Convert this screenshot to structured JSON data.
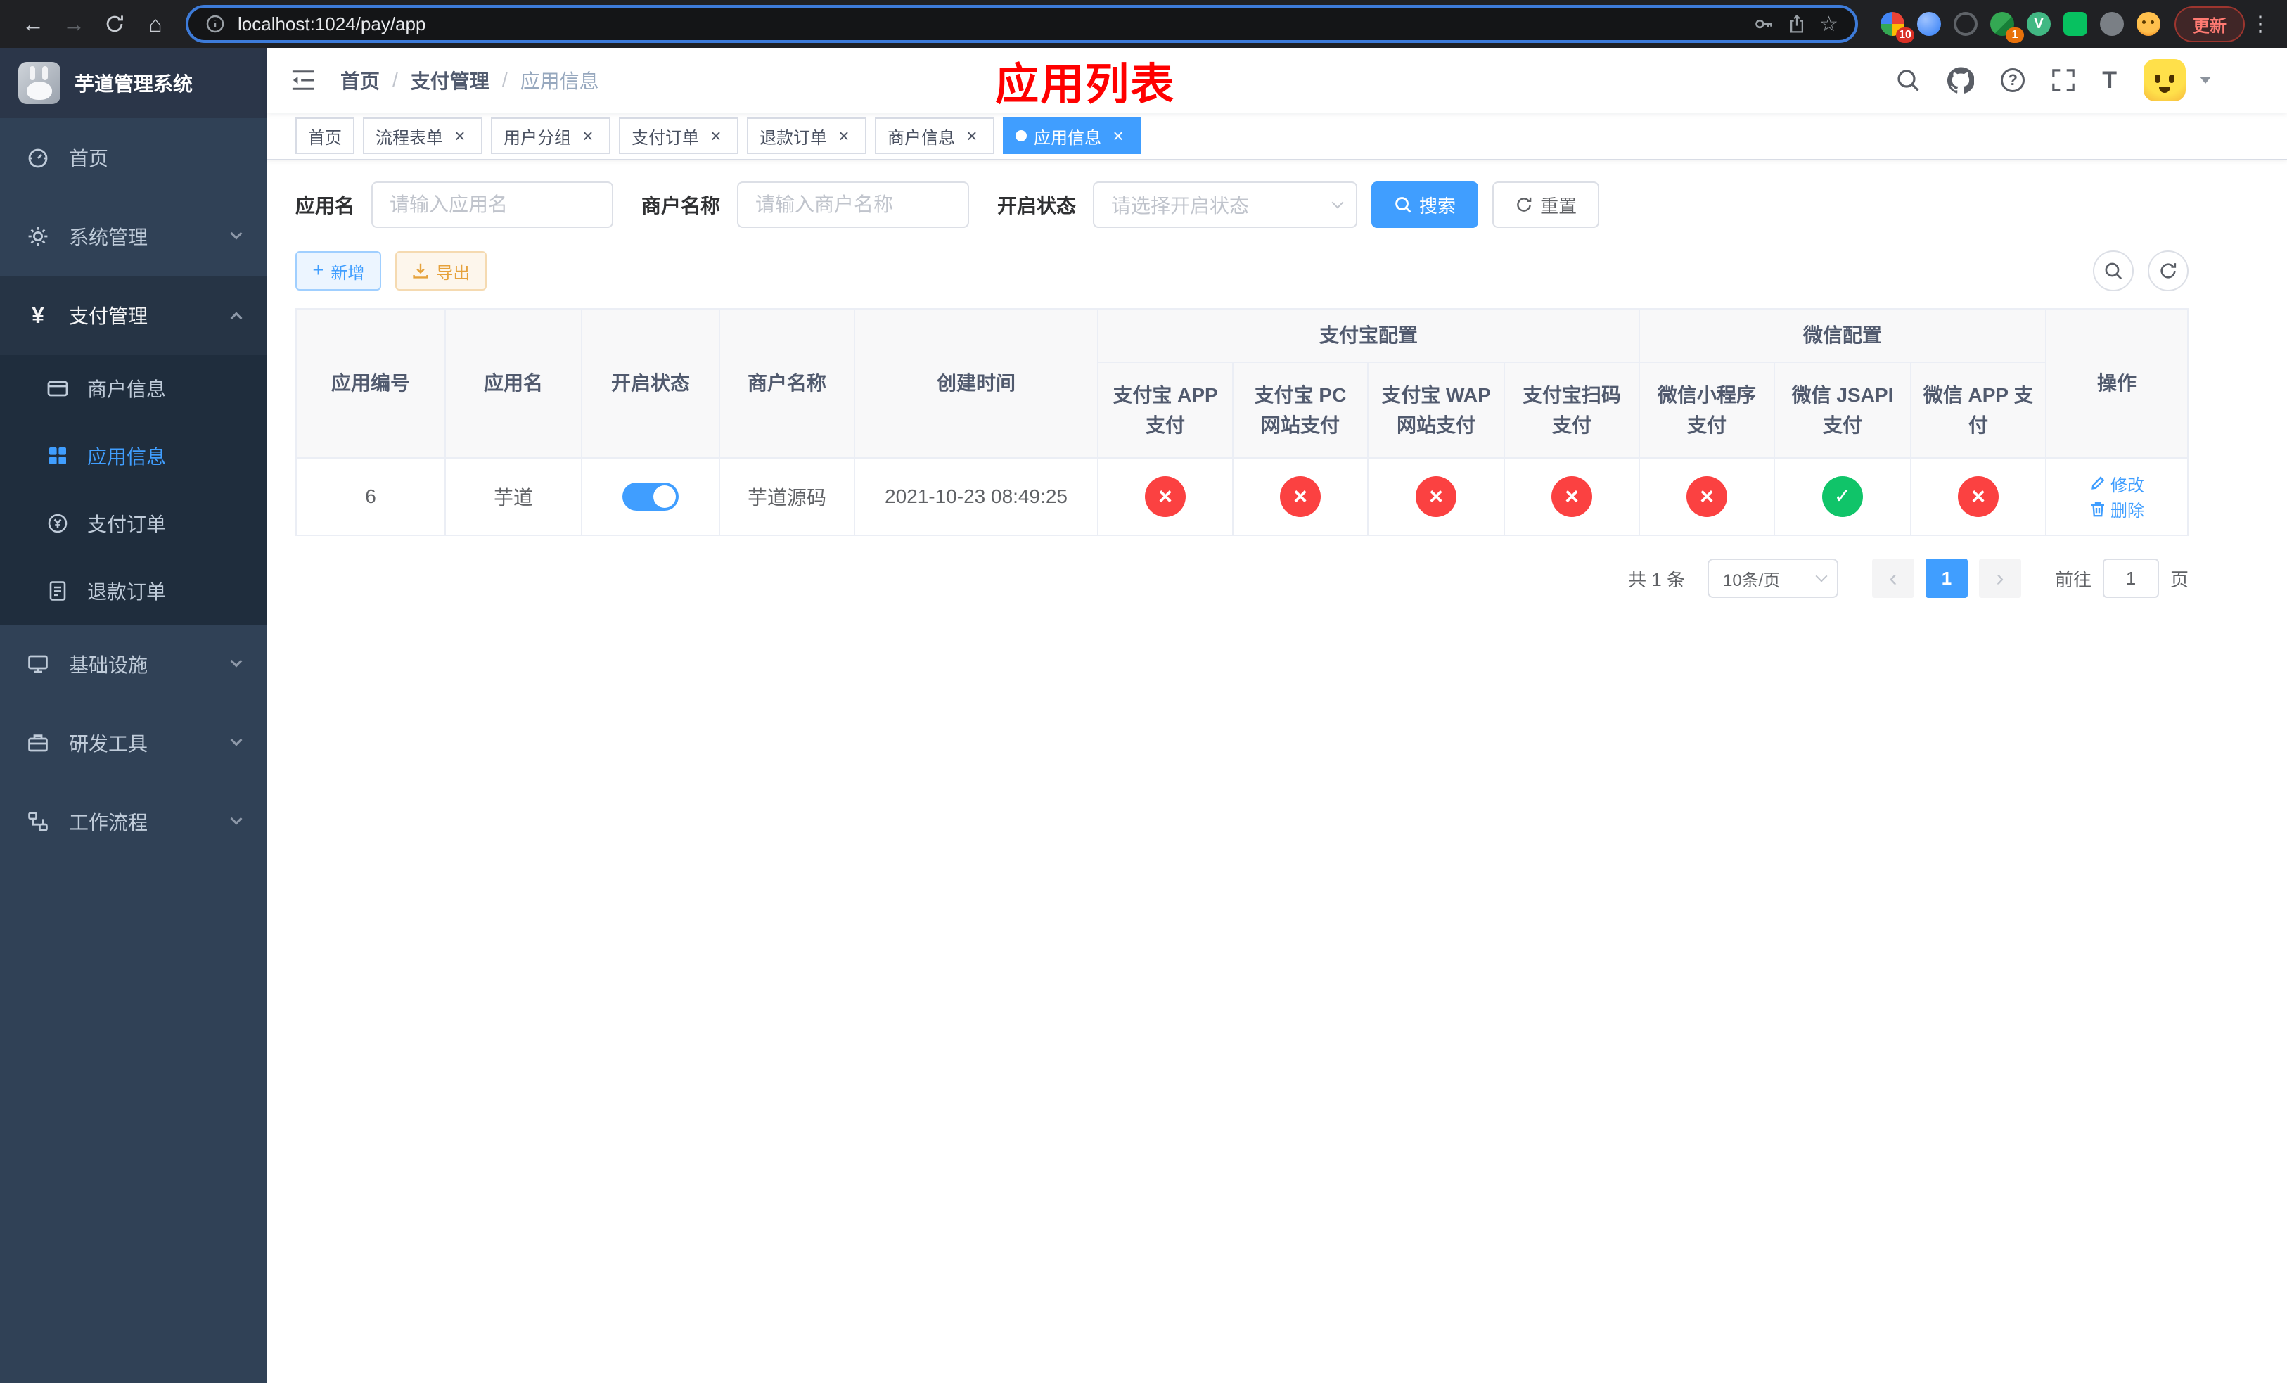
{
  "colors": {
    "primary": "#409eff",
    "danger_circle": "#fb4141",
    "success_circle": "#10c469",
    "warning": "#e6a23c",
    "sidebar_bg": "#304156",
    "title_red": "#ff0000"
  },
  "browser": {
    "url": "localhost:1024/pay/app",
    "update_label": "更新",
    "extension_badge_count": "10",
    "translate_badge_count": "1"
  },
  "sidebar": {
    "title": "芋道管理系统",
    "menu_home": "首页",
    "menu_system": "系统管理",
    "menu_pay": "支付管理",
    "menu_infra": "基础设施",
    "menu_devtools": "研发工具",
    "menu_workflow": "工作流程",
    "sub_merchant": "商户信息",
    "sub_app": "应用信息",
    "sub_pay_order": "支付订单",
    "sub_refund_order": "退款订单"
  },
  "header": {
    "crumb_home": "首页",
    "crumb_pay": "支付管理",
    "crumb_current": "应用信息",
    "separator": "/",
    "overlay_title": "应用列表"
  },
  "tabs": {
    "home": "首页",
    "process_form": "流程表单",
    "user_group": "用户分组",
    "pay_order": "支付订单",
    "refund_order": "退款订单",
    "merchant_info": "商户信息",
    "app_info": "应用信息"
  },
  "filters": {
    "app_name_label": "应用名",
    "app_name_placeholder": "请输入应用名",
    "merchant_label": "商户名称",
    "merchant_placeholder": "请输入商户名称",
    "status_label": "开启状态",
    "status_placeholder": "请选择开启状态",
    "search_label": "搜索",
    "reset_label": "重置"
  },
  "toolbar": {
    "add_label": "新增",
    "export_label": "导出"
  },
  "table": {
    "col_id": "应用编号",
    "col_name": "应用名",
    "col_status": "开启状态",
    "col_merchant": "商户名称",
    "col_created": "创建时间",
    "group_alipay": "支付宝配置",
    "group_wechat": "微信配置",
    "col_alipay_app": "支付宝 APP 支付",
    "col_alipay_pc": "支付宝 PC 网站支付",
    "col_alipay_wap": "支付宝 WAP 网站支付",
    "col_alipay_scan": "支付宝扫码支付",
    "col_wechat_mini": "微信小程序支付",
    "col_wechat_jsapi": "微信 JSAPI 支付",
    "col_wechat_app": "微信 APP 支付",
    "col_action": "操作",
    "row": {
      "id": "6",
      "name": "芋道",
      "enabled": true,
      "merchant": "芋道源码",
      "created_at": "2021-10-23 08:49:25",
      "channel_status": [
        "disabled",
        "disabled",
        "disabled",
        "disabled",
        "disabled",
        "enabled",
        "disabled"
      ],
      "edit_label": "修改",
      "delete_label": "删除"
    }
  },
  "pagination": {
    "total_text": "共 1 条",
    "page_size_text": "10条/页",
    "current_page": "1",
    "goto_label": "前往",
    "goto_value": "1",
    "goto_unit": "页"
  }
}
